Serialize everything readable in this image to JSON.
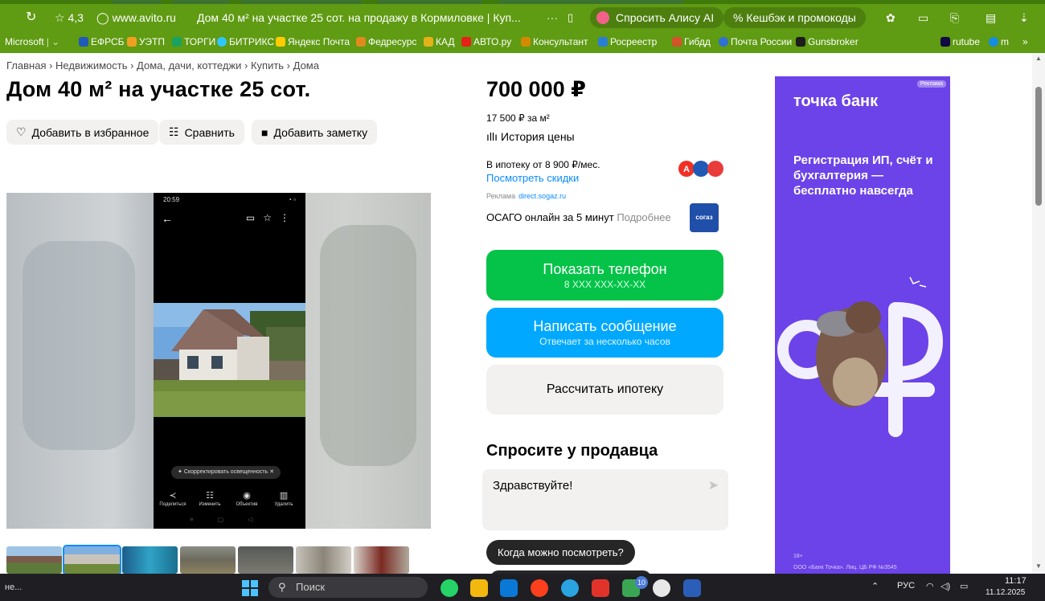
{
  "browser": {
    "rating": "4,3",
    "domain": "www.avito.ru",
    "tab_title": "Дом 40 м² на участке 25 сот. на продажу в Кормиловке | Куп...",
    "more": "···",
    "alice_label": "Спросить Алису AI",
    "cashback_label": "Кешбэк и промокоды"
  },
  "bookmarks": [
    {
      "label": "Microsoft",
      "color": "#f25022"
    },
    {
      "label": "ЕФРСБ",
      "color": "#1f5ab6"
    },
    {
      "label": "УЭТП",
      "color": "#f0a020"
    },
    {
      "label": "ТОРГИ",
      "color": "#1aa260"
    },
    {
      "label": "БИТРИКС",
      "color": "#2fc6f6"
    },
    {
      "label": "Яндекс Почта",
      "color": "#ffcc00"
    },
    {
      "label": "Федресурс",
      "color": "#e08a1e"
    },
    {
      "label": "КАД",
      "color": "#e4b21a"
    },
    {
      "label": "АВТО.ру",
      "color": "#e62117"
    },
    {
      "label": "Консультант",
      "color": "#d48a00"
    },
    {
      "label": "Росреестр",
      "color": "#2a7fd4"
    },
    {
      "label": "Гибдд",
      "color": "#d4542a"
    },
    {
      "label": "Почта России",
      "color": "#2f6fd6"
    },
    {
      "label": "Gunsbroker",
      "color": "#1d1d1d"
    },
    {
      "label": "rutube",
      "color": "#100943"
    },
    {
      "label": "m",
      "color": "#168de2"
    },
    {
      "label": "»",
      "color": ""
    }
  ],
  "breadcrumb": "Главная › Недвижимость › Дома, дачи, коттеджи › Купить › Дома",
  "title": "Дом 40 м² на участке 25 сот.",
  "actions": {
    "favorite": "Добавить в избранное",
    "compare": "Сравнить",
    "note": "Добавить заметку"
  },
  "gallery": {
    "status_time": "20:59",
    "correct_chip": "Скорректировать освещенность",
    "tools": [
      "Поделиться",
      "Изменить",
      "Объектив",
      "Удалить"
    ]
  },
  "price": {
    "value": "700 000 ₽",
    "per_m2": "17 500 ₽ за м²",
    "history": "История цены"
  },
  "mortgage": {
    "text": "В ипотеку от 8 900 ₽/мес.",
    "discounts": "Посмотреть скидки"
  },
  "ad_inline": {
    "label": "Реклама",
    "domain": "direct.sogaz.ru",
    "text": "ОСАГО онлайн за 5 минут",
    "more": "Подробнее",
    "logo": "согаз"
  },
  "buttons": {
    "phone_main": "Показать телефон",
    "phone_sub": "8 XXX XXX-XX-XX",
    "message_main": "Написать сообщение",
    "message_sub": "Отвечает за несколько часов",
    "calc": "Рассчитать ипотеку"
  },
  "ask": {
    "title": "Спросите у продавца",
    "text": "Здравствуйте!",
    "chip": "Когда можно посмотреть?"
  },
  "side_ad": {
    "tag": "Реклама",
    "brand": "точка банк",
    "headline": "Регистрация ИП, счёт и бухгалтерия — бесплатно навсегда",
    "age": "18+",
    "legal": "ООО «Банк Точка». Лиц. ЦБ РФ №3545"
  },
  "taskbar": {
    "left": "не...",
    "search": "Поиск",
    "lang": "РУС",
    "time": "11:17",
    "date": "11.12.2025"
  },
  "colors": {
    "browser_green": "#5f9b13",
    "phone_green": "#04c348",
    "message_blue": "#00a9ff",
    "ad_purple": "#6c43e8"
  }
}
